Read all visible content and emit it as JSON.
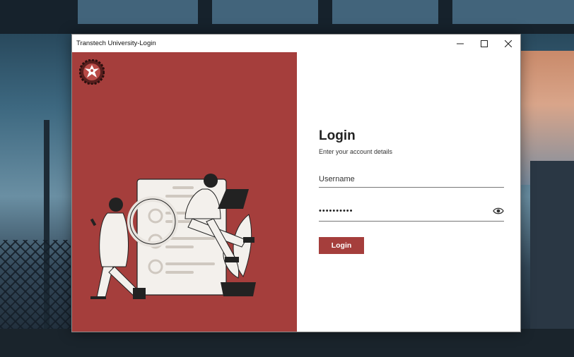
{
  "window": {
    "title": "Transtech University-Login",
    "controls": {
      "minimize_icon": "minimize-icon",
      "maximize_icon": "maximize-icon",
      "close_icon": "close-icon"
    }
  },
  "login": {
    "heading": "Login",
    "subheading": "Enter your account details",
    "username": {
      "placeholder": "Username",
      "value": ""
    },
    "password": {
      "value": "••••••••••",
      "toggle_icon": "eye-icon"
    },
    "button_label": "Login"
  },
  "colors": {
    "brand": "#a53e3c",
    "panel_bg": "#ffffff",
    "text": "#222222"
  },
  "logo_icon": "university-crest-icon"
}
